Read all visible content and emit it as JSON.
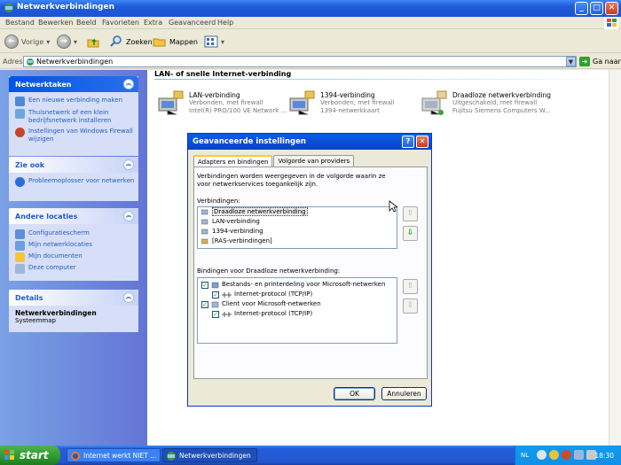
{
  "window": {
    "title": "Netwerkverbindingen"
  },
  "menu": [
    "Bestand",
    "Bewerken",
    "Beeld",
    "Favorieten",
    "Extra",
    "Geavanceerd",
    "Help"
  ],
  "toolbar": {
    "back": "Vorige",
    "search": "Zoeken",
    "folders": "Mappen"
  },
  "address": {
    "label": "Adres",
    "value": "Netwerkverbindingen",
    "go": "Ga naar"
  },
  "sidebar": {
    "tasks": {
      "title": "Netwerktaken",
      "items": [
        "Een nieuwe verbinding maken",
        "Thuisnetwerk of een klein bedrijfsnetwerk installeren",
        "Instellingen van Windows Firewall wijzigen"
      ]
    },
    "see_also": {
      "title": "Zie ook",
      "items": [
        "Probleemoplosser voor netwerken"
      ]
    },
    "other": {
      "title": "Andere locaties",
      "items": [
        "Configuratiescherm",
        "Mijn netwerklocaties",
        "Mijn documenten",
        "Deze computer"
      ]
    },
    "details": {
      "title": "Details",
      "name": "Netwerkverbindingen",
      "type": "Systeemmap"
    }
  },
  "content": {
    "section_title": "LAN- of snelle Internet-verbinding",
    "connections": [
      {
        "name": "LAN-verbinding",
        "status": "Verbonden, met firewall",
        "device": "Intel(R) PRO/100 VE Network ..."
      },
      {
        "name": "1394-verbinding",
        "status": "Verbonden, met firewall",
        "device": "1394-netwerkkaart"
      },
      {
        "name": "Draadloze netwerkverbinding",
        "status": "Uitgeschakeld, met firewall",
        "device": "Fujitsu Siemens Computers W..."
      }
    ]
  },
  "dialog": {
    "title": "Geavanceerde instellingen",
    "tabs": [
      "Adapters en bindingen",
      "Volgorde van providers"
    ],
    "description": "Verbindingen worden weergegeven in de volgorde waarin ze voor netwerkservices toegankelijk zijn.",
    "connections_label": "Verbindingen:",
    "connections": [
      "Draadloze netwerkverbinding",
      "LAN-verbinding",
      "1394-verbinding",
      "[RAS-verbindingen]"
    ],
    "bindings_label": "Bindingen voor Draadloze netwerkverbinding:",
    "bindings": [
      {
        "label": "Bestands- en printerdeling voor Microsoft-netwerken",
        "indent": 0
      },
      {
        "label": "Internet-protocol (TCP/IP)",
        "indent": 1
      },
      {
        "label": "Client voor Microsoft-netwerken",
        "indent": 0
      },
      {
        "label": "Internet-protocol (TCP/IP)",
        "indent": 1
      }
    ],
    "ok": "OK",
    "cancel": "Annuleren"
  },
  "taskbar": {
    "start": "start",
    "tasks": [
      "Internet werkt NIET ...",
      "Netwerkverbindingen"
    ],
    "lang": "NL",
    "clock": "18:30"
  }
}
